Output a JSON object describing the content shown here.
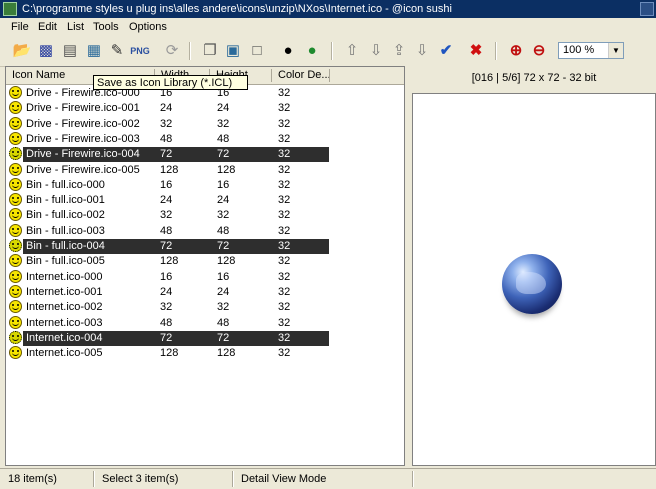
{
  "window": {
    "title": "C:\\programme styles u plug ins\\alles andere\\icons\\unzip\\NXos\\Internet.ico - @icon sushi"
  },
  "menu": [
    "File",
    "Edit",
    "List",
    "Tools",
    "Options"
  ],
  "toolbar": {
    "zoom": "100 %"
  },
  "tooltip": "Save as Icon Library (*.ICL)",
  "list": {
    "columns": [
      "Icon Name",
      "Width",
      "Height",
      "Color De..."
    ],
    "rows": [
      {
        "name": "Drive - Firewire.ico-000",
        "w": "16",
        "h": "16",
        "c": "32"
      },
      {
        "name": "Drive - Firewire.ico-001",
        "w": "24",
        "h": "24",
        "c": "32"
      },
      {
        "name": "Drive - Firewire.ico-002",
        "w": "32",
        "h": "32",
        "c": "32"
      },
      {
        "name": "Drive - Firewire.ico-003",
        "w": "48",
        "h": "48",
        "c": "32"
      },
      {
        "name": "Drive - Firewire.ico-004",
        "w": "72",
        "h": "72",
        "c": "32",
        "selected": true
      },
      {
        "name": "Drive - Firewire.ico-005",
        "w": "128",
        "h": "128",
        "c": "32"
      },
      {
        "name": "Bin - full.ico-000",
        "w": "16",
        "h": "16",
        "c": "32"
      },
      {
        "name": "Bin - full.ico-001",
        "w": "24",
        "h": "24",
        "c": "32"
      },
      {
        "name": "Bin - full.ico-002",
        "w": "32",
        "h": "32",
        "c": "32"
      },
      {
        "name": "Bin - full.ico-003",
        "w": "48",
        "h": "48",
        "c": "32"
      },
      {
        "name": "Bin - full.ico-004",
        "w": "72",
        "h": "72",
        "c": "32",
        "selected": true
      },
      {
        "name": "Bin - full.ico-005",
        "w": "128",
        "h": "128",
        "c": "32"
      },
      {
        "name": "Internet.ico-000",
        "w": "16",
        "h": "16",
        "c": "32"
      },
      {
        "name": "Internet.ico-001",
        "w": "24",
        "h": "24",
        "c": "32"
      },
      {
        "name": "Internet.ico-002",
        "w": "32",
        "h": "32",
        "c": "32"
      },
      {
        "name": "Internet.ico-003",
        "w": "48",
        "h": "48",
        "c": "32"
      },
      {
        "name": "Internet.ico-004",
        "w": "72",
        "h": "72",
        "c": "32",
        "selected": true
      },
      {
        "name": "Internet.ico-005",
        "w": "128",
        "h": "128",
        "c": "32"
      }
    ]
  },
  "preview": {
    "info": "[016 | 5/6] 72 x 72 - 32 bit"
  },
  "status": {
    "count": "18 item(s)",
    "selected": "Select 3 item(s)",
    "mode": "Detail View Mode"
  }
}
